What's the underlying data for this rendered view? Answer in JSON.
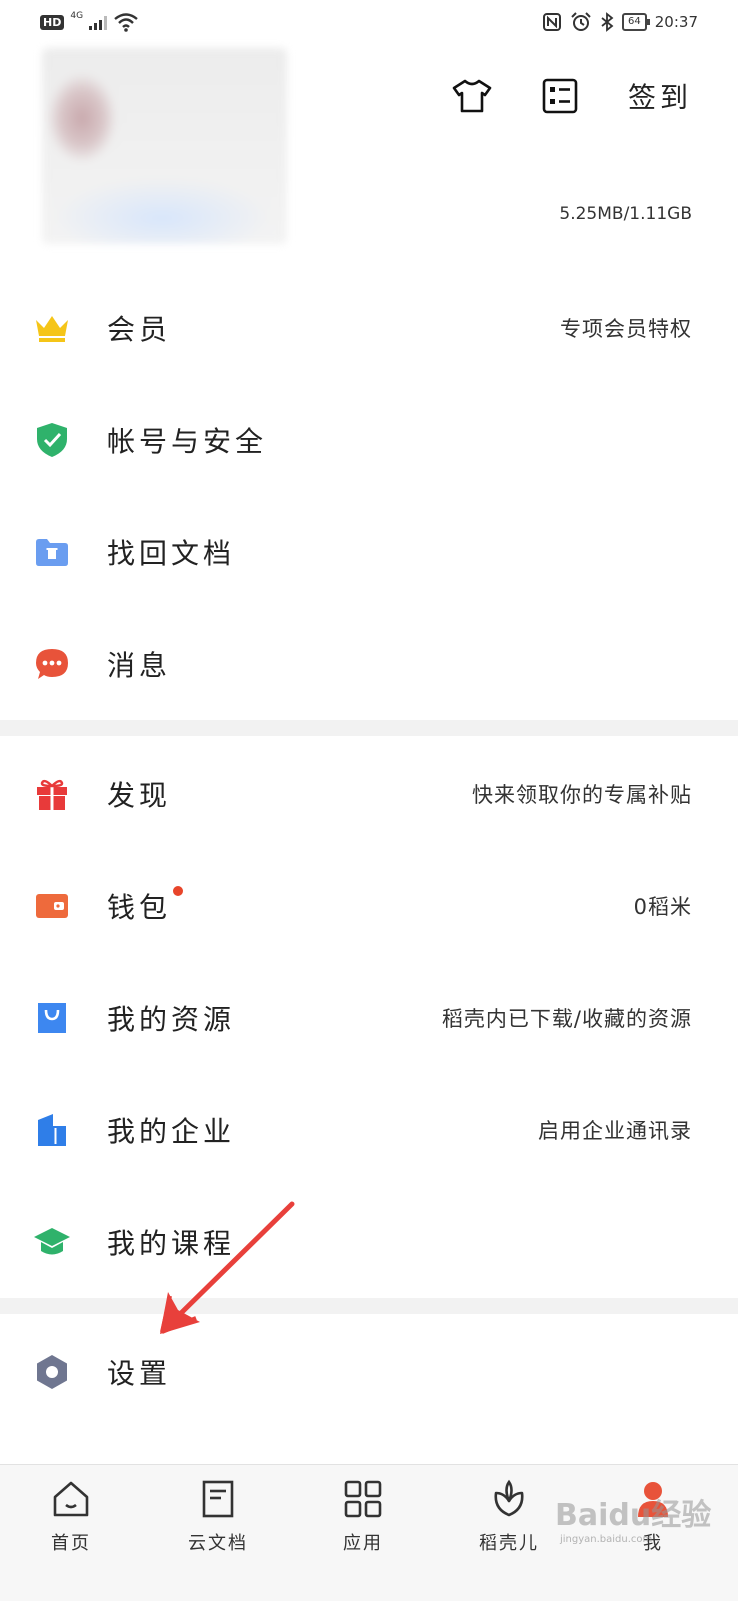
{
  "status_bar": {
    "network": "HD",
    "signal_type": "4G",
    "battery": "64",
    "time": "20:37"
  },
  "header": {
    "icons": [
      "tshirt-icon",
      "checklist-icon"
    ],
    "signin_label": "签到",
    "storage": "5.25MB/1.11GB"
  },
  "menu": {
    "vip": {
      "label": "会员",
      "sub": "专项会员特权",
      "color": "#f5c518"
    },
    "account": {
      "label": "帐号与安全",
      "color": "#2fb26b"
    },
    "recover": {
      "label": "找回文档",
      "color": "#6a9df0"
    },
    "messages": {
      "label": "消息",
      "color": "#e8533a"
    },
    "discover": {
      "label": "发现",
      "sub": "快来领取你的专属补贴",
      "color": "#e83a3a"
    },
    "wallet": {
      "label": "钱包",
      "sub": "0稻米",
      "color": "#ee6a3c"
    },
    "resources": {
      "label": "我的资源",
      "sub": "稻壳内已下载/收藏的资源",
      "color": "#3d87f0"
    },
    "enterprise": {
      "label": "我的企业",
      "sub": "启用企业通讯录",
      "color": "#2f7ee8"
    },
    "courses": {
      "label": "我的课程",
      "color": "#2fb26b"
    },
    "settings": {
      "label": "设置",
      "color": "#6f7690"
    }
  },
  "bottom_nav": {
    "home": "首页",
    "cloud_docs": "云文档",
    "apps": "应用",
    "docer": "稻壳儿",
    "me": "我"
  },
  "watermark": {
    "text": "Baidu经验",
    "url_text": "jingyan.baidu.com"
  }
}
